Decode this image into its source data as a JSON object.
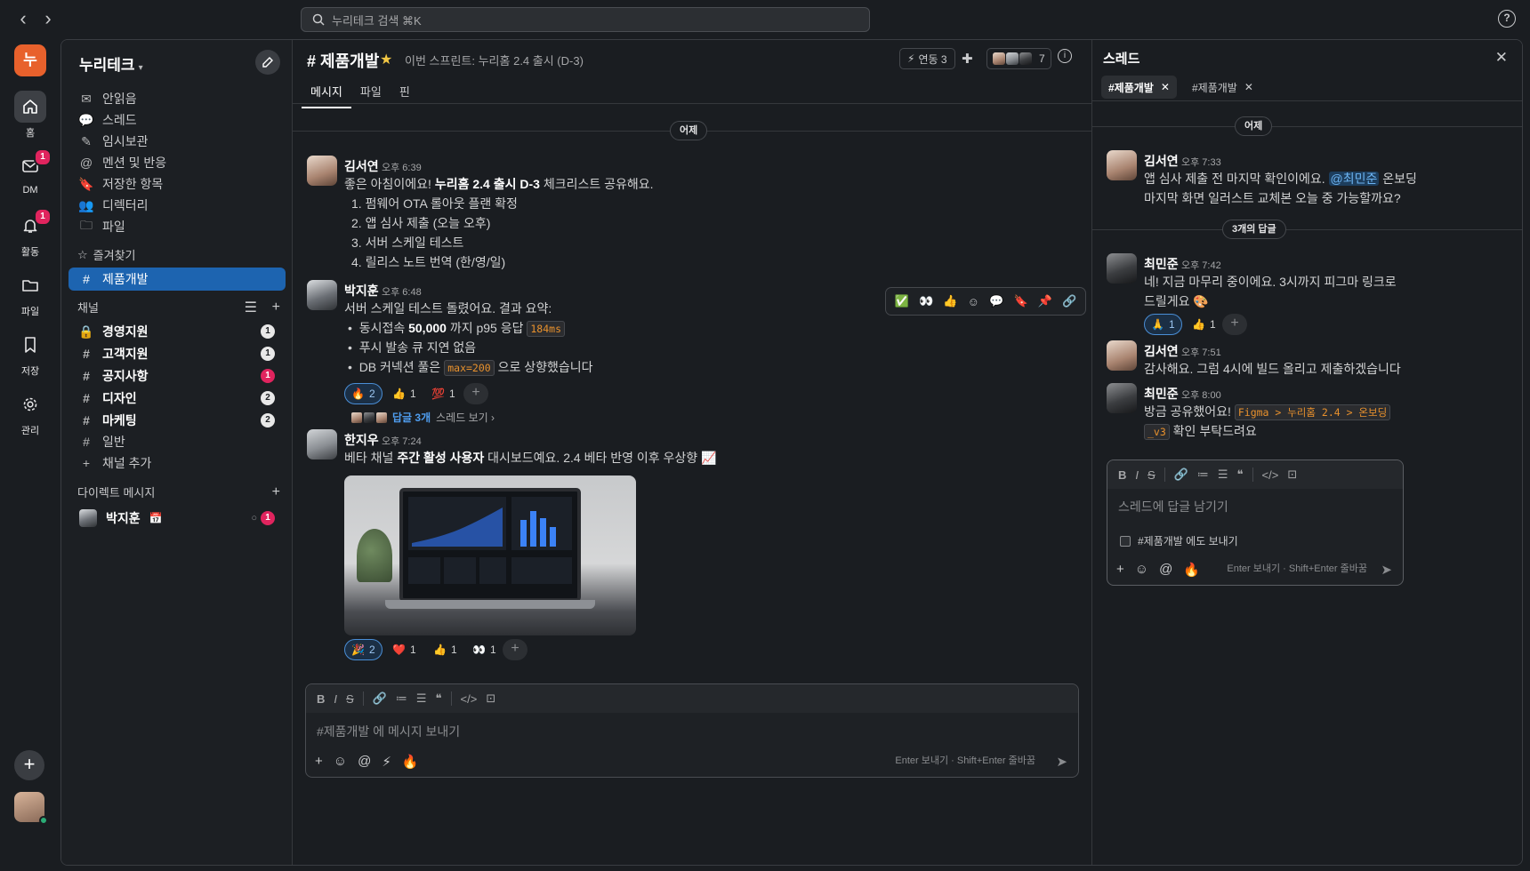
{
  "search": {
    "placeholder": "누리테크 검색 ⌘K"
  },
  "nav": {
    "back": "‹",
    "forward": "›",
    "help": "?"
  },
  "rail": {
    "workspace_initial": "누",
    "items": [
      {
        "label": "홈",
        "badge": ""
      },
      {
        "label": "DM",
        "badge": "1"
      },
      {
        "label": "활동",
        "badge": "1"
      },
      {
        "label": "파일",
        "badge": ""
      },
      {
        "label": "저장",
        "badge": ""
      },
      {
        "label": "관리",
        "badge": ""
      }
    ],
    "add": "+"
  },
  "sidebar": {
    "workspace": "누리테크",
    "nav_items": [
      "안읽음",
      "스레드",
      "임시보관",
      "멘션 및 반응",
      "저장한 항목",
      "디렉터리",
      "파일"
    ],
    "favorites_label": "즐겨찾기",
    "favorites": [
      {
        "name": "제품개발"
      }
    ],
    "channels_label": "채널",
    "channels": [
      {
        "name": "경영지원",
        "count": "1"
      },
      {
        "name": "고객지원",
        "count": "1"
      },
      {
        "name": "공지사항",
        "count": "1"
      },
      {
        "name": "디자인",
        "count": "2"
      },
      {
        "name": "마케팅",
        "count": "2"
      },
      {
        "name": "일반",
        "count": ""
      }
    ],
    "add_channel": "채널 추가",
    "dm_label": "다이렉트 메시지",
    "dms": [
      {
        "name": "박지훈",
        "status_emoji": "📅",
        "count": "1"
      }
    ]
  },
  "channel": {
    "title": "# 제품개발",
    "topic": "이번 스프린트: 누리홈 2.4 출시 (D-3)",
    "integrations": "연동 3",
    "member_count": "7",
    "tabs": [
      "메시지",
      "파일",
      "핀"
    ],
    "date_divider": "어제"
  },
  "messages": [
    {
      "author": "김서연",
      "time": "오후 6:39",
      "intro_pre": "좋은 아침이에요! ",
      "intro_bold": "누리홈 2.4 출시 D-3",
      "intro_post": " 체크리스트 공유해요.",
      "list": [
        "1. 펌웨어 OTA 롤아웃 플랜 확정",
        "2. 앱 심사 제출 (오늘 오후)",
        "3. 서버 스케일 테스트",
        "4. 릴리스 노트 번역 (한/영/일)"
      ]
    },
    {
      "author": "박지훈",
      "time": "오후 6:48",
      "intro": "서버 스케일 테스트 돌렸어요. 결과 요약:",
      "b1_pre": "동시접속 ",
      "b1_bold": "50,000",
      "b1_mid": " 까지 p95 응답 ",
      "b1_code": "184ms",
      "b2": "푸시 발송 큐 지연 없음",
      "b3_pre": "DB 커넥션 풀은 ",
      "b3_code": "max=200",
      "b3_post": " 으로 상향했습니다",
      "reactions": [
        {
          "emoji": "🔥",
          "count": "2"
        },
        {
          "emoji": "👍",
          "count": "1"
        },
        {
          "emoji": "💯",
          "count": "1"
        }
      ],
      "replies": "답글 3개",
      "view_thread": "스레드 보기 ›"
    },
    {
      "author": "한지우",
      "time": "오후 7:24",
      "text_pre": "베타 채널 ",
      "text_bold": "주간 활성 사용자",
      "text_post": " 대시보드예요. 2.4 베타 반영 이후 우상향 📈",
      "reactions": [
        {
          "emoji": "🎉",
          "count": "2"
        },
        {
          "emoji": "❤️",
          "count": "1"
        },
        {
          "emoji": "👍",
          "count": "1"
        },
        {
          "emoji": "👀",
          "count": "1"
        }
      ]
    }
  ],
  "hover_actions": [
    "✅",
    "👀",
    "👍",
    "☺",
    "💬",
    "🔖",
    "📌",
    "🔗"
  ],
  "composer": {
    "format_buttons": [
      "B",
      "I",
      "S",
      "🔗",
      "≔",
      "☰",
      "❝",
      "</>",
      "⊡"
    ],
    "placeholder": "#제품개발 에 메시지 보내기",
    "hint": "Enter 보내기 · Shift+Enter 줄바꿈",
    "tools": [
      "+",
      "☺",
      "@",
      "⚡",
      "🔥"
    ],
    "send": "➤"
  },
  "thread": {
    "title": "스레드",
    "close": "✕",
    "tabs": [
      "#제품개발",
      "#제품개발"
    ],
    "date": "어제",
    "root": {
      "author": "김서연",
      "time": "오후 7:33",
      "pre": "앱 심사 제출 전 마지막 확인이에요. ",
      "mention": "@최민준",
      "post": " 온보딩",
      "line2": "마지막 화면 일러스트 교체본 오늘 중 가능할까요?"
    },
    "reply_count": "3개의 답글",
    "replies": [
      {
        "author": "최민준",
        "time": "오후 7:42",
        "line1": "네! 지금 마무리 중이에요. 3시까지 피그마 링크로",
        "line2": "드릴게요 🎨",
        "reactions": [
          {
            "emoji": "🙏",
            "count": "1"
          },
          {
            "emoji": "👍",
            "count": "1"
          }
        ]
      },
      {
        "author": "김서연",
        "time": "오후 7:51",
        "line1": "감사해요. 그럼 4시에 빌드 올리고 제출하겠습니다"
      },
      {
        "author": "최민준",
        "time": "오후 8:00",
        "pre": "방금 공유했어요! ",
        "code1": "Figma > 누리홈 2.4 > 온보딩",
        "code2": "_v3",
        "post": " 확인 부탁드려요"
      }
    ],
    "composer": {
      "placeholder": "스레드에 답글 남기기",
      "also_send": "#제품개발 에도 보내기",
      "hint": "Enter 보내기 · Shift+Enter 줄바꿈"
    }
  }
}
